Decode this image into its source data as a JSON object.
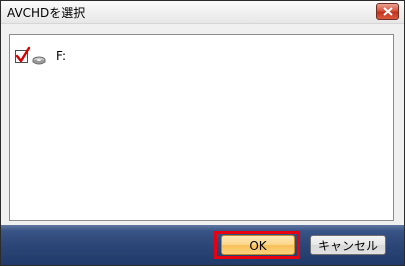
{
  "window": {
    "title": "AVCHDを選択"
  },
  "list": {
    "items": [
      {
        "label": "F:",
        "checked": true,
        "icon": "drive-icon"
      }
    ]
  },
  "buttons": {
    "ok_label": "OK",
    "cancel_label": "キャンセル"
  },
  "colors": {
    "footer": "#2c4677",
    "highlight": "#e60012",
    "ok_button": "#fbd68a",
    "close_button": "#c1301a",
    "check": "#d40000"
  }
}
